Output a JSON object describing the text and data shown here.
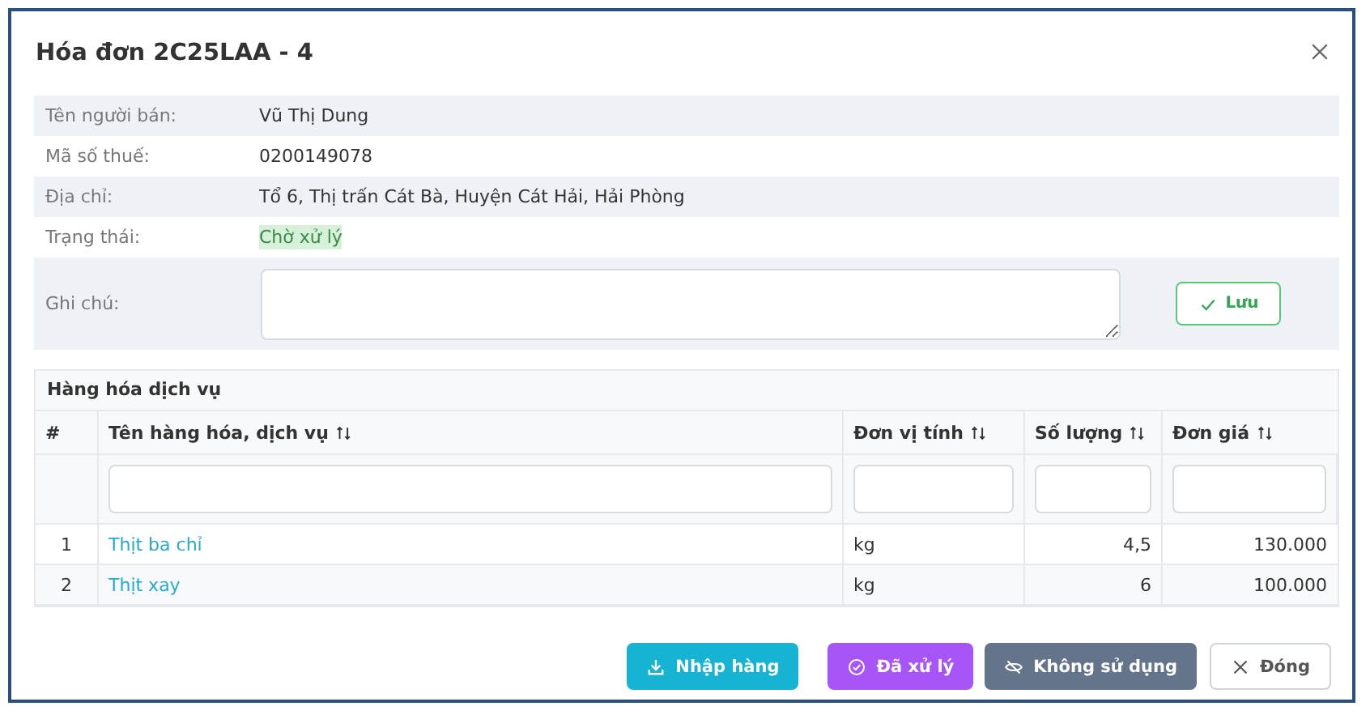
{
  "dialog": {
    "title": "Hóa đơn 2C25LAA - 4"
  },
  "fields": [
    {
      "label": "Tên người bán:",
      "value": "Vũ Thị Dung"
    },
    {
      "label": "Mã số thuế:",
      "value": "0200149078"
    },
    {
      "label": "Địa chỉ:",
      "value": "Tổ 6, Thị trấn Cát Bà, Huyện Cát Hải, Hải Phòng"
    },
    {
      "label": "Trạng thái:",
      "value": "Chờ xử lý",
      "kind": "status"
    }
  ],
  "note": {
    "label": "Ghi chú:",
    "save_button": "Lưu"
  },
  "table": {
    "title": "Hàng hóa dịch vụ",
    "columns": [
      {
        "label": "#",
        "sortable": false,
        "filter": false
      },
      {
        "label": "Tên hàng hóa, dịch vụ",
        "sortable": true,
        "filter": true
      },
      {
        "label": "Đơn vị tính",
        "sortable": true,
        "filter": true
      },
      {
        "label": "Số lượng",
        "sortable": true,
        "filter": true
      },
      {
        "label": "Đơn giá",
        "sortable": true,
        "filter": true
      }
    ],
    "rows": [
      [
        "1",
        "Thịt ba chỉ",
        "kg",
        "4,5",
        "130.000"
      ],
      [
        "2",
        "Thịt xay",
        "kg",
        "6",
        "100.000"
      ]
    ]
  },
  "buttons": [
    {
      "label": "Nhập hàng",
      "kind": "import"
    },
    {
      "label": "Đã xử lý",
      "kind": "done"
    },
    {
      "label": "Không sử dụng",
      "kind": "unused"
    },
    {
      "label": "Đóng",
      "kind": "close"
    }
  ]
}
